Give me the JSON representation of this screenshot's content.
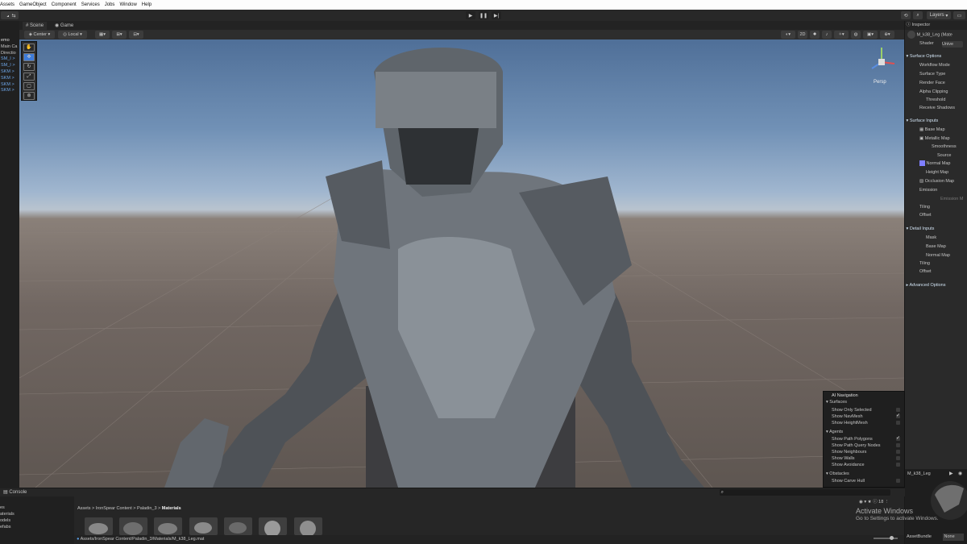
{
  "menu": [
    "Assets",
    "GameObject",
    "Component",
    "Services",
    "Jobs",
    "Window",
    "Help"
  ],
  "toolbar": {
    "play_icon": "play-icon",
    "pause_icon": "pause-icon",
    "step_icon": "step-icon",
    "layers_label": "Layers"
  },
  "hierarchy": {
    "items": [
      "emo",
      "Main Ca",
      "Directio",
      "SM_I  >",
      "SM_I  >",
      "SKM  >",
      "SKM  >",
      "SKM  >",
      "SKM  >"
    ]
  },
  "scene": {
    "tabs": [
      "Scene",
      "Game"
    ],
    "pivot_label": "Center",
    "space_label": "Local",
    "mode_2d": "2D",
    "gizmo_label": "Persp"
  },
  "inspector": {
    "title": "Inspector",
    "material_name": "M_k38_Leg (Mate",
    "shader_label": "Shader",
    "shader_value": "Unive",
    "sections": {
      "surface_options": "Surface Options",
      "surface_inputs": "Surface Inputs",
      "detail_inputs": "Detail Inputs",
      "advanced_options": "Advanced Options"
    },
    "surface_options_rows": [
      "Workflow Mode",
      "Surface Type",
      "Render Face",
      "Alpha Clipping",
      "Threshold",
      "Receive Shadows"
    ],
    "surface_inputs_rows": [
      "Base Map",
      "Metallic Map",
      "Smoothness",
      "Source",
      "Normal Map",
      "Height Map",
      "Occlusion Map",
      "Emission",
      "Emission M",
      "Tiling",
      "Offset"
    ],
    "detail_inputs_rows": [
      "Mask",
      "Base Map",
      "Normal Map",
      "Tiling",
      "Offset"
    ]
  },
  "ai_navigation": {
    "title": "AI Navigation",
    "surfaces_header": "Surfaces",
    "surfaces": [
      {
        "label": "Show Only Selected",
        "checked": false
      },
      {
        "label": "Show NavMesh",
        "checked": true
      },
      {
        "label": "Show HeightMesh",
        "checked": false
      }
    ],
    "agents_header": "Agents",
    "agents": [
      {
        "label": "Show Path Polygons",
        "checked": true
      },
      {
        "label": "Show Path Query Nodes",
        "checked": false
      },
      {
        "label": "Show Neighbours",
        "checked": false
      },
      {
        "label": "Show Walls",
        "checked": false
      },
      {
        "label": "Show Avoidance",
        "checked": false
      }
    ],
    "obstacles_header": "Obstacles",
    "obstacles": [
      {
        "label": "Show Carve Hull",
        "checked": false
      }
    ]
  },
  "bottom": {
    "console_tab": "Console",
    "project_tree": [
      "es",
      "aterials",
      "odels",
      "efabs"
    ],
    "breadcrumb": [
      "Assets",
      "IronSpear Content",
      "Paladin_3",
      "Materials"
    ],
    "path": "Assets/IronSpear Content/Paladin_3/Materials/M_k38_Leg.mat",
    "item_count": "18",
    "preview_name": "M_k38_Leg",
    "asset_bundle_label": "AssetBundle",
    "asset_bundle_value": "None"
  },
  "watermark": {
    "title": "Activate Windows",
    "subtitle": "Go to Settings to activate Windows."
  },
  "colors": {
    "sky_top": "#4f6f98",
    "ground": "#716762",
    "accent_blue": "#3d7bd9"
  }
}
